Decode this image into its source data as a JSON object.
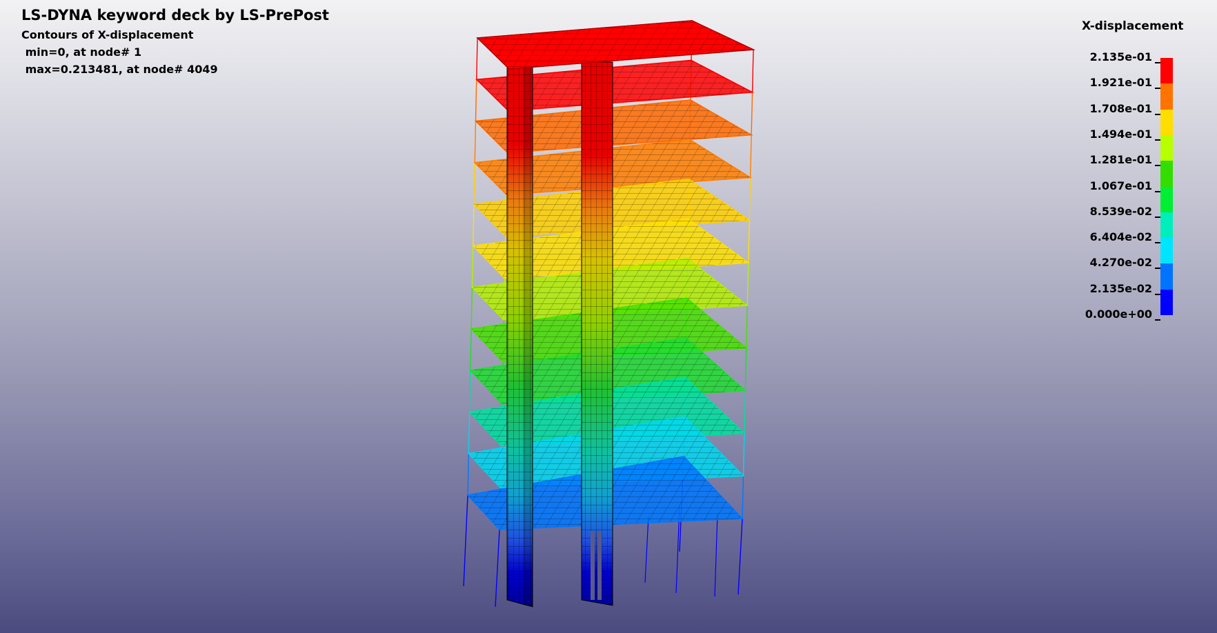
{
  "header": {
    "title": "LS-DYNA keyword deck by LS-PrePost",
    "subtitle": "Contours of X-displacement",
    "min_line": " min=0, at node# 1",
    "max_line": " max=0.213481, at node# 4049"
  },
  "legend": {
    "title": "X-displacement",
    "labels": [
      "2.135e-01",
      "1.921e-01",
      "1.708e-01",
      "1.494e-01",
      "1.281e-01",
      "1.067e-01",
      "8.539e-02",
      "6.404e-02",
      "4.270e-02",
      "2.135e-02",
      "0.000e+00"
    ],
    "colors": [
      "#ff0000",
      "#ff7300",
      "#ffdd00",
      "#b8ff00",
      "#33dd00",
      "#00ee33",
      "#00eebb",
      "#00e5ff",
      "#0073ff",
      "#0000ff"
    ]
  },
  "model": {
    "floor_colors": [
      "#ff0000",
      "#ff0000",
      "#ff6a00",
      "#ff7e00",
      "#ffd000",
      "#ffe000",
      "#b4f000",
      "#48e000",
      "#20dd30",
      "#00e0a0",
      "#00d8f0",
      "#0078ff"
    ]
  }
}
